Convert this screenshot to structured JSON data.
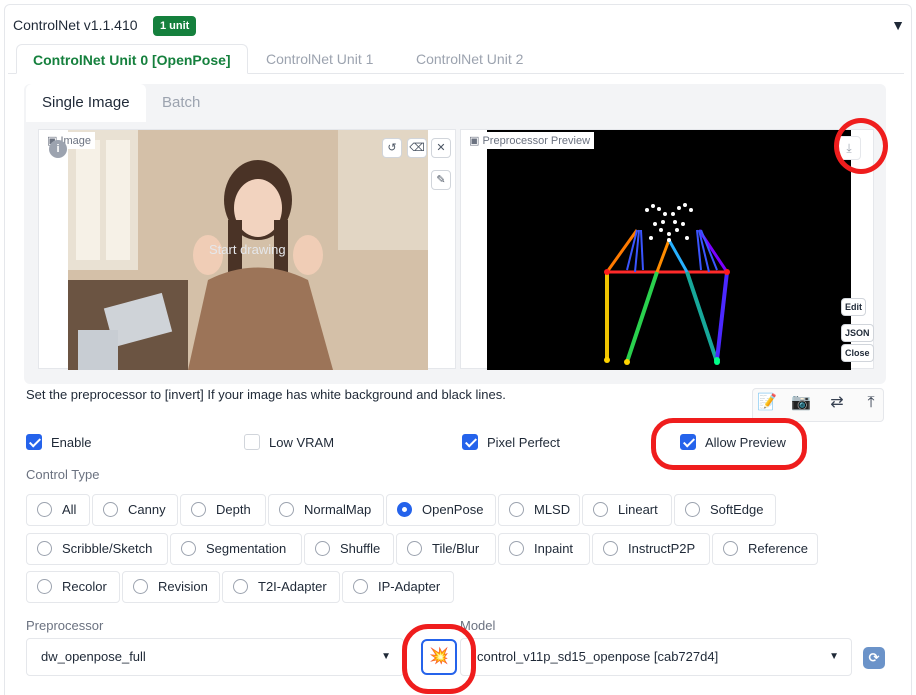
{
  "header": {
    "title": "ControlNet v1.1.410",
    "badge": "1 unit",
    "collapse_icon": "triangle-down"
  },
  "unit_tabs": [
    "ControlNet Unit 0 [OpenPose]",
    "ControlNet Unit 1",
    "ControlNet Unit 2"
  ],
  "image_tabs": [
    "Single Image",
    "Batch"
  ],
  "image_panel": {
    "label": "Image",
    "overlay": "Start drawing",
    "tools": [
      "undo-icon",
      "eraser-icon",
      "close-icon",
      "brush-icon"
    ]
  },
  "preview_panel": {
    "label": "Preprocessor Preview",
    "side_buttons": [
      "Edit",
      "JSON",
      "Close"
    ]
  },
  "hint": "Set the preprocessor to [invert] If your image has white background and black lines.",
  "icon_buttons": [
    "notepad-icon",
    "camera-icon",
    "swap-icon",
    "upload-arrow-icon"
  ],
  "options": {
    "enable": "Enable",
    "low_vram": "Low VRAM",
    "pixel_perfect": "Pixel Perfect",
    "allow_preview": "Allow Preview"
  },
  "control_type": {
    "label": "Control Type",
    "selected": "OpenPose",
    "rows": [
      [
        "All",
        "Canny",
        "Depth",
        "NormalMap",
        "OpenPose",
        "MLSD",
        "Lineart",
        "SoftEdge"
      ],
      [
        "Scribble/Sketch",
        "Segmentation",
        "Shuffle",
        "Tile/Blur",
        "Inpaint",
        "InstructP2P",
        "Reference"
      ],
      [
        "Recolor",
        "Revision",
        "T2I-Adapter",
        "IP-Adapter"
      ]
    ]
  },
  "preprocessor": {
    "label": "Preprocessor",
    "value": "dw_openpose_full"
  },
  "model": {
    "label": "Model",
    "value": "control_v11p_sd15_openpose [cab727d4]"
  },
  "colors": {
    "accent": "#15803d",
    "checkbox": "#2563eb",
    "highlight": "#ef1d1d"
  }
}
